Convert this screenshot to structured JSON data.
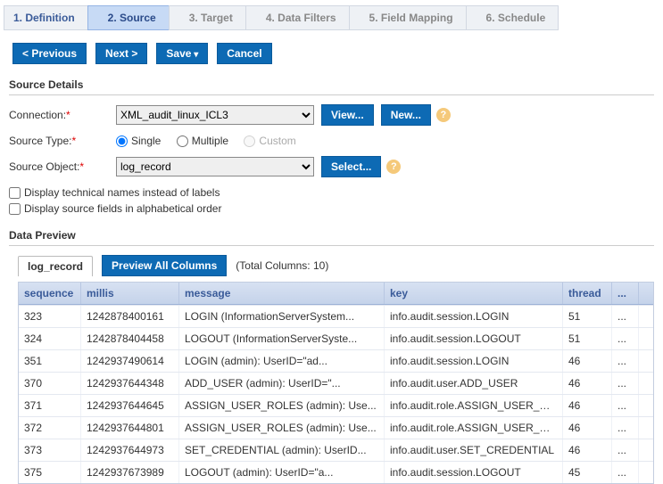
{
  "wizard": [
    {
      "label": "1. Definition",
      "state": "done"
    },
    {
      "label": "2. Source",
      "state": "active"
    },
    {
      "label": "3. Target",
      "state": ""
    },
    {
      "label": "4. Data Filters",
      "state": ""
    },
    {
      "label": "5. Field Mapping",
      "state": ""
    },
    {
      "label": "6. Schedule",
      "state": ""
    }
  ],
  "buttons": {
    "prev": "< Previous",
    "next": "Next >",
    "save": "Save",
    "cancel": "Cancel"
  },
  "source_details": {
    "title": "Source Details",
    "connection_label": "Connection:",
    "connection_value": "XML_audit_linux_ICL3",
    "view": "View...",
    "newbtn": "New...",
    "type_label": "Source Type:",
    "type_options": {
      "single": "Single",
      "multiple": "Multiple",
      "custom": "Custom"
    },
    "type_selected": "single",
    "object_label": "Source Object:",
    "object_value": "log_record",
    "select": "Select...",
    "chk_tech": "Display technical names instead of labels",
    "chk_alpha": "Display source fields in alphabetical order"
  },
  "preview": {
    "title": "Data Preview",
    "tab_record": "log_record",
    "tab_all": "Preview All Columns",
    "total_cols": "(Total Columns: 10)",
    "columns": [
      "sequence",
      "millis",
      "message",
      "key",
      "thread",
      "..."
    ],
    "rows": [
      {
        "sequence": "323",
        "millis": "1242878400161",
        "message": "LOGIN (InformationServerSystem...",
        "key": "info.audit.session.LOGIN",
        "thread": "51",
        "more": "..."
      },
      {
        "sequence": "324",
        "millis": "1242878404458",
        "message": "LOGOUT (InformationServerSyste...",
        "key": "info.audit.session.LOGOUT",
        "thread": "51",
        "more": "..."
      },
      {
        "sequence": "351",
        "millis": "1242937490614",
        "message": "LOGIN (admin): UserID=\"ad...",
        "key": "info.audit.session.LOGIN",
        "thread": "46",
        "more": "..."
      },
      {
        "sequence": "370",
        "millis": "1242937644348",
        "message": "ADD_USER (admin): UserID=\"...",
        "key": "info.audit.user.ADD_USER",
        "thread": "46",
        "more": "..."
      },
      {
        "sequence": "371",
        "millis": "1242937644645",
        "message": "ASSIGN_USER_ROLES (admin): Use...",
        "key": "info.audit.role.ASSIGN_USER_RO...",
        "thread": "46",
        "more": "..."
      },
      {
        "sequence": "372",
        "millis": "1242937644801",
        "message": "ASSIGN_USER_ROLES (admin): Use...",
        "key": "info.audit.role.ASSIGN_USER_RO...",
        "thread": "46",
        "more": "..."
      },
      {
        "sequence": "373",
        "millis": "1242937644973",
        "message": "SET_CREDENTIAL (admin): UserID...",
        "key": "info.audit.user.SET_CREDENTIAL",
        "thread": "46",
        "more": "..."
      },
      {
        "sequence": "375",
        "millis": "1242937673989",
        "message": "LOGOUT (admin): UserID=\"a...",
        "key": "info.audit.session.LOGOUT",
        "thread": "45",
        "more": "..."
      }
    ]
  }
}
